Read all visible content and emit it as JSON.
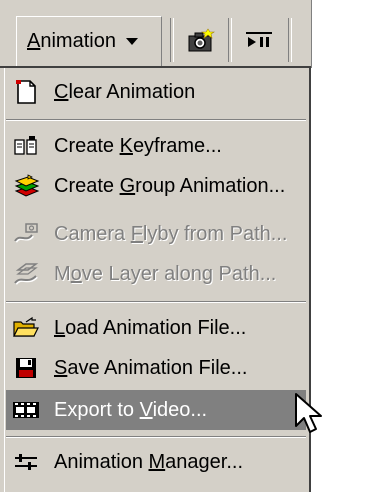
{
  "toolbar": {
    "dropdown": {
      "pre": "",
      "mnemonic": "A",
      "post": "nimation"
    },
    "buttons": [
      {
        "icon": "camera-icon"
      },
      {
        "icon": "play-pause-icon"
      }
    ]
  },
  "menu": {
    "items": [
      {
        "pre": "",
        "mnemonic": "C",
        "post": "lear Animation",
        "icon": "clear-page-icon",
        "enabled": true
      },
      {
        "pre": "Create ",
        "mnemonic": "K",
        "post": "eyframe...",
        "icon": "keyframe-icon",
        "enabled": true
      },
      {
        "pre": "Create ",
        "mnemonic": "G",
        "post": "roup Animation...",
        "icon": "group-animation-icon",
        "enabled": true
      },
      {
        "pre": "Camera ",
        "mnemonic": "F",
        "post": "lyby from Path...",
        "icon": "camera-path-icon",
        "enabled": false
      },
      {
        "pre": "M",
        "mnemonic": "o",
        "post": "ve Layer along Path...",
        "icon": "layer-path-icon",
        "enabled": false
      },
      {
        "pre": "",
        "mnemonic": "L",
        "post": "oad Animation File...",
        "icon": "open-folder-icon",
        "enabled": true
      },
      {
        "pre": "",
        "mnemonic": "S",
        "post": "ave Animation File...",
        "icon": "floppy-disk-icon",
        "enabled": true
      },
      {
        "pre": "Export to ",
        "mnemonic": "V",
        "post": "ideo...",
        "icon": "film-strip-icon",
        "enabled": true,
        "highlighted": true
      },
      {
        "pre": "Animation ",
        "mnemonic": "M",
        "post": "anager...",
        "icon": "sliders-icon",
        "enabled": true
      }
    ]
  },
  "colors": {
    "menu_bg": "#d4d0c8",
    "highlight_bg": "#808080",
    "disabled_text": "#808080"
  }
}
